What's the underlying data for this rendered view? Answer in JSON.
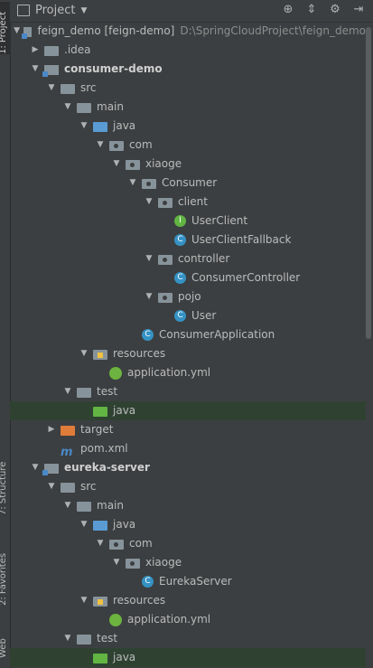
{
  "toolbar": {
    "title": "Project"
  },
  "side_tabs": {
    "project": "1: Project",
    "structure": "7: Structure",
    "favorites": "2: Favorites",
    "web": "Web"
  },
  "tree": [
    {
      "depth": 0,
      "arrow": "open",
      "icon": "module",
      "label": "feign_demo [feign-demo]",
      "path": "D:\\SpringCloudProject\\feign_demo",
      "bold": false,
      "name": "tree-item-feign-demo"
    },
    {
      "depth": 1,
      "arrow": "closed",
      "icon": "folder",
      "label": ".idea",
      "name": "tree-item-idea"
    },
    {
      "depth": 1,
      "arrow": "open",
      "icon": "module",
      "label": "consumer-demo",
      "bold": true,
      "name": "tree-item-consumer-demo"
    },
    {
      "depth": 2,
      "arrow": "open",
      "icon": "folder",
      "label": "src",
      "name": "tree-item-src"
    },
    {
      "depth": 3,
      "arrow": "open",
      "icon": "folder",
      "label": "main",
      "name": "tree-item-main"
    },
    {
      "depth": 4,
      "arrow": "open",
      "icon": "folder-blue",
      "label": "java",
      "name": "tree-item-java"
    },
    {
      "depth": 5,
      "arrow": "open",
      "icon": "package",
      "label": "com",
      "name": "tree-item-com"
    },
    {
      "depth": 6,
      "arrow": "open",
      "icon": "package",
      "label": "xiaoge",
      "name": "tree-item-xiaoge"
    },
    {
      "depth": 7,
      "arrow": "open",
      "icon": "package",
      "label": "Consumer",
      "name": "tree-item-consumer"
    },
    {
      "depth": 8,
      "arrow": "open",
      "icon": "package",
      "label": "client",
      "name": "tree-item-client"
    },
    {
      "depth": 9,
      "arrow": "none",
      "icon": "interface",
      "label": "UserClient",
      "name": "tree-item-userclient"
    },
    {
      "depth": 9,
      "arrow": "none",
      "icon": "class",
      "label": "UserClientFallback",
      "name": "tree-item-userclientfallback"
    },
    {
      "depth": 8,
      "arrow": "open",
      "icon": "package",
      "label": "controller",
      "name": "tree-item-controller"
    },
    {
      "depth": 9,
      "arrow": "none",
      "icon": "class",
      "label": "ConsumerController",
      "name": "tree-item-consumercontroller"
    },
    {
      "depth": 8,
      "arrow": "open",
      "icon": "package",
      "label": "pojo",
      "name": "tree-item-pojo"
    },
    {
      "depth": 9,
      "arrow": "none",
      "icon": "class",
      "label": "User",
      "name": "tree-item-user"
    },
    {
      "depth": 7,
      "arrow": "none",
      "icon": "spring-class",
      "label": "ConsumerApplication",
      "name": "tree-item-consumerapplication"
    },
    {
      "depth": 4,
      "arrow": "open",
      "icon": "resources",
      "label": "resources",
      "name": "tree-item-resources"
    },
    {
      "depth": 5,
      "arrow": "none",
      "icon": "spring-yml",
      "label": "application.yml",
      "name": "tree-item-application-yml"
    },
    {
      "depth": 3,
      "arrow": "open",
      "icon": "folder",
      "label": "test",
      "name": "tree-item-test"
    },
    {
      "depth": 4,
      "arrow": "none",
      "icon": "folder-green",
      "label": "java",
      "highlight": true,
      "name": "tree-item-test-java"
    },
    {
      "depth": 2,
      "arrow": "closed",
      "icon": "folder-orange",
      "label": "target",
      "name": "tree-item-target"
    },
    {
      "depth": 2,
      "arrow": "none",
      "icon": "maven",
      "label": "pom.xml",
      "name": "tree-item-pom-xml"
    },
    {
      "depth": 1,
      "arrow": "open",
      "icon": "module",
      "label": "eureka-server",
      "bold": true,
      "name": "tree-item-eureka-server"
    },
    {
      "depth": 2,
      "arrow": "open",
      "icon": "folder",
      "label": "src",
      "name": "tree-item-eureka-src"
    },
    {
      "depth": 3,
      "arrow": "open",
      "icon": "folder",
      "label": "main",
      "name": "tree-item-eureka-main"
    },
    {
      "depth": 4,
      "arrow": "open",
      "icon": "folder-blue",
      "label": "java",
      "name": "tree-item-eureka-java"
    },
    {
      "depth": 5,
      "arrow": "open",
      "icon": "package",
      "label": "com",
      "name": "tree-item-eureka-com"
    },
    {
      "depth": 6,
      "arrow": "open",
      "icon": "package",
      "label": "xiaoge",
      "name": "tree-item-eureka-xiaoge"
    },
    {
      "depth": 7,
      "arrow": "none",
      "icon": "spring-class",
      "label": "EurekaServer",
      "name": "tree-item-eurekaserver"
    },
    {
      "depth": 4,
      "arrow": "open",
      "icon": "resources",
      "label": "resources",
      "name": "tree-item-eureka-resources"
    },
    {
      "depth": 5,
      "arrow": "none",
      "icon": "spring-yml",
      "label": "application.yml",
      "name": "tree-item-eureka-application-yml"
    },
    {
      "depth": 3,
      "arrow": "open",
      "icon": "folder",
      "label": "test",
      "name": "tree-item-eureka-test"
    },
    {
      "depth": 4,
      "arrow": "none",
      "icon": "folder-green",
      "label": "java",
      "highlight": true,
      "name": "tree-item-eureka-test-java"
    }
  ]
}
